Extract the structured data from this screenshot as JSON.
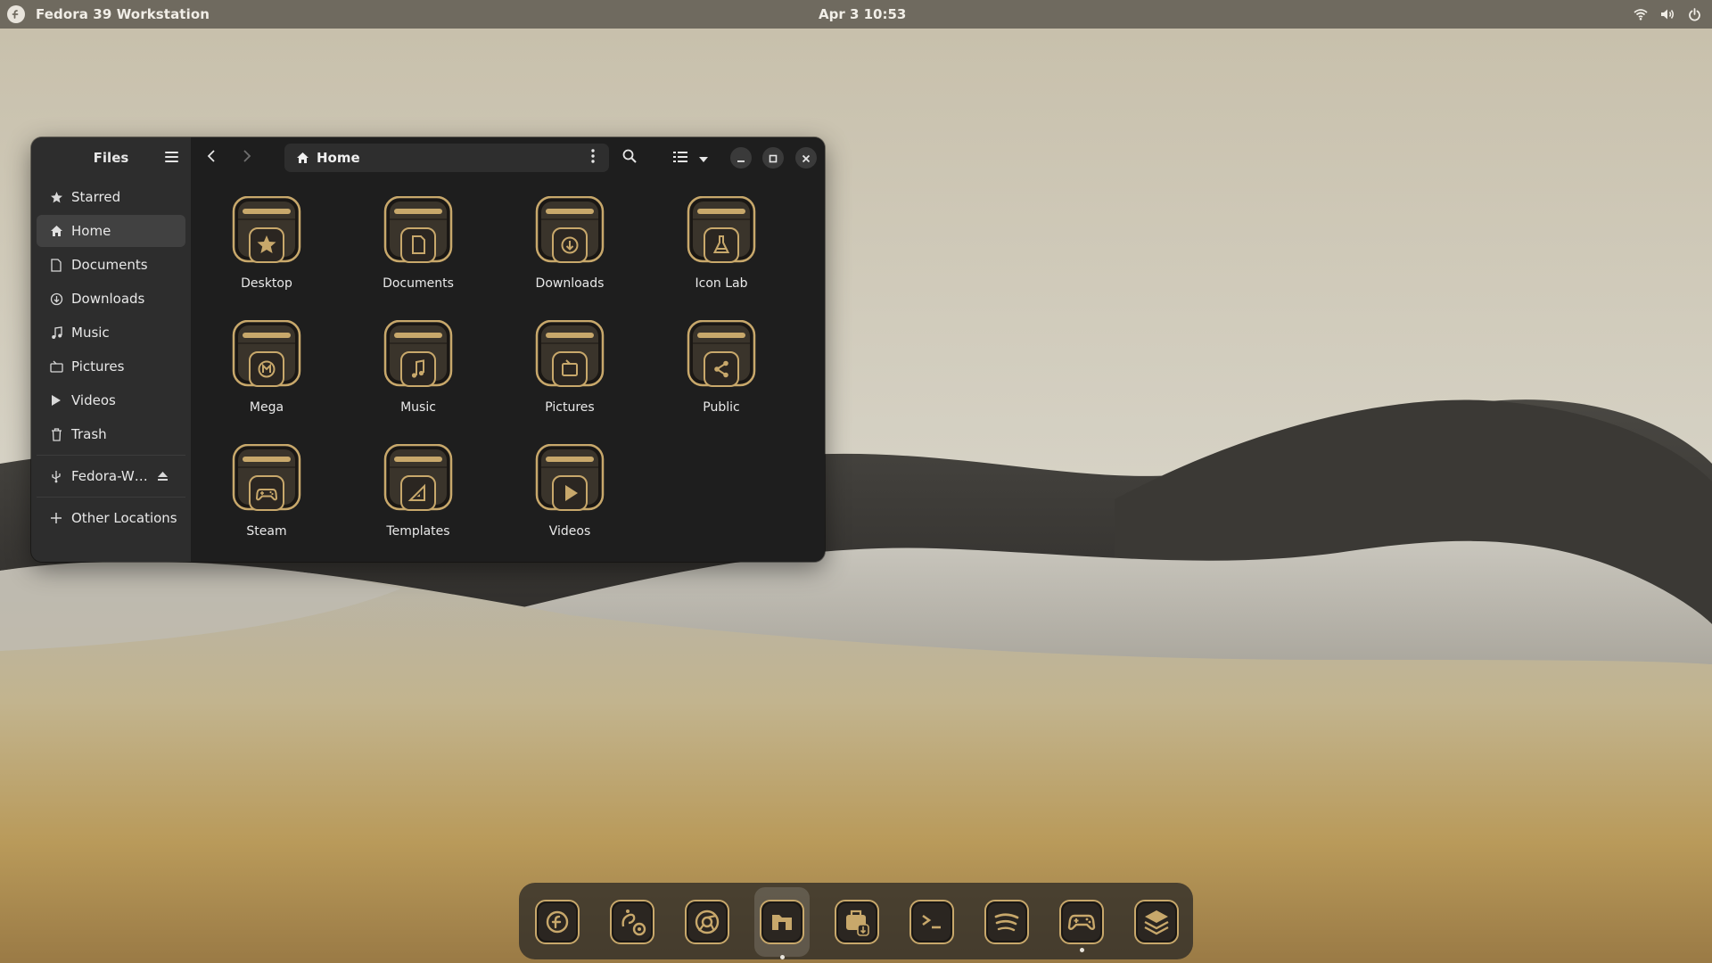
{
  "topbar": {
    "os_title": "Fedora 39 Workstation",
    "clock": "Apr 3  10:53",
    "tray_icons": [
      "wifi-icon",
      "volume-icon",
      "power-icon"
    ]
  },
  "files": {
    "sidebar_title": "Files",
    "sidebar_items": [
      {
        "label": "Starred",
        "icon": "star-icon"
      },
      {
        "label": "Home",
        "icon": "home-icon",
        "active": true
      },
      {
        "label": "Documents",
        "icon": "document-icon"
      },
      {
        "label": "Downloads",
        "icon": "download-icon"
      },
      {
        "label": "Music",
        "icon": "music-icon"
      },
      {
        "label": "Pictures",
        "icon": "pictures-icon"
      },
      {
        "label": "Videos",
        "icon": "play-icon"
      },
      {
        "label": "Trash",
        "icon": "trash-icon"
      }
    ],
    "drive": {
      "label": "Fedora-W…",
      "icon": "usb-icon"
    },
    "other_locations": "Other Locations",
    "path": "Home",
    "folders": [
      {
        "label": "Desktop",
        "glyph": "star"
      },
      {
        "label": "Documents",
        "glyph": "doc"
      },
      {
        "label": "Downloads",
        "glyph": "down"
      },
      {
        "label": "Icon Lab",
        "glyph": "flask"
      },
      {
        "label": "Mega",
        "glyph": "mega"
      },
      {
        "label": "Music",
        "glyph": "music"
      },
      {
        "label": "Pictures",
        "glyph": "picture"
      },
      {
        "label": "Public",
        "glyph": "share"
      },
      {
        "label": "Steam",
        "glyph": "gamepad"
      },
      {
        "label": "Templates",
        "glyph": "template"
      },
      {
        "label": "Videos",
        "glyph": "play"
      }
    ]
  },
  "dock": {
    "apps": [
      {
        "icon": "fedora-icon"
      },
      {
        "icon": "gnome-settings-icon"
      },
      {
        "icon": "chrome-icon"
      },
      {
        "icon": "files-icon",
        "active": true,
        "running": true
      },
      {
        "icon": "software-install-icon"
      },
      {
        "icon": "terminal-icon"
      },
      {
        "icon": "spotify-icon"
      },
      {
        "icon": "game-controller-icon",
        "running": true
      },
      {
        "icon": "layers-icon"
      }
    ]
  },
  "colors": {
    "folder_gold": "#c8a86b",
    "folder_body": "#3a342b",
    "window_bg": "#1e1e1e",
    "sidebar_bg": "#2d2d2d"
  }
}
